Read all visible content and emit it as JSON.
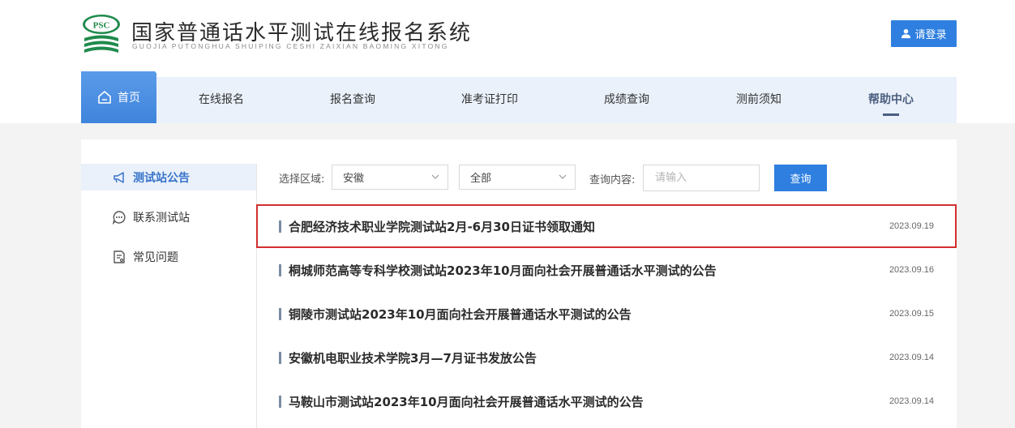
{
  "header": {
    "logo_text": "PSC",
    "site_title": "国家普通话水平测试在线报名系统",
    "site_subtitle": "GUOJIA PUTONGHUA SHUIPING CESHI ZAIXIAN BAOMING XITONG",
    "login_label": "请登录",
    "accent_color": "#2f7fe0"
  },
  "nav": {
    "items": [
      {
        "label": "首页"
      },
      {
        "label": "在线报名"
      },
      {
        "label": "报名查询"
      },
      {
        "label": "准考证打印"
      },
      {
        "label": "成绩查询"
      },
      {
        "label": "测前须知"
      },
      {
        "label": "帮助中心"
      }
    ],
    "active": "帮助中心"
  },
  "sidebar": {
    "items": [
      {
        "label": "测试站公告",
        "icon": "megaphone-icon"
      },
      {
        "label": "联系测试站",
        "icon": "chat-bubble-icon"
      },
      {
        "label": "常见问题",
        "icon": "document-question-icon"
      }
    ]
  },
  "filter": {
    "region_label": "选择区域:",
    "region_value": "安徽",
    "scope_value": "全部",
    "query_label": "查询内容:",
    "query_placeholder": "请输入",
    "search_label": "查询"
  },
  "notices": [
    {
      "title": "合肥经济技术职业学院测试站2月-6月30日证书领取通知",
      "date": "2023.09.19"
    },
    {
      "title": "桐城师范高等专科学校测试站2023年10月面向社会开展普通话水平测试的公告",
      "date": "2023.09.16"
    },
    {
      "title": "铜陵市测试站2023年10月面向社会开展普通话水平测试的公告",
      "date": "2023.09.15"
    },
    {
      "title": "安徽机电职业技术学院3月—7月证书发放公告",
      "date": "2023.09.14"
    },
    {
      "title": "马鞍山市测试站2023年10月面向社会开展普通话水平测试的公告",
      "date": "2023.09.14"
    }
  ]
}
